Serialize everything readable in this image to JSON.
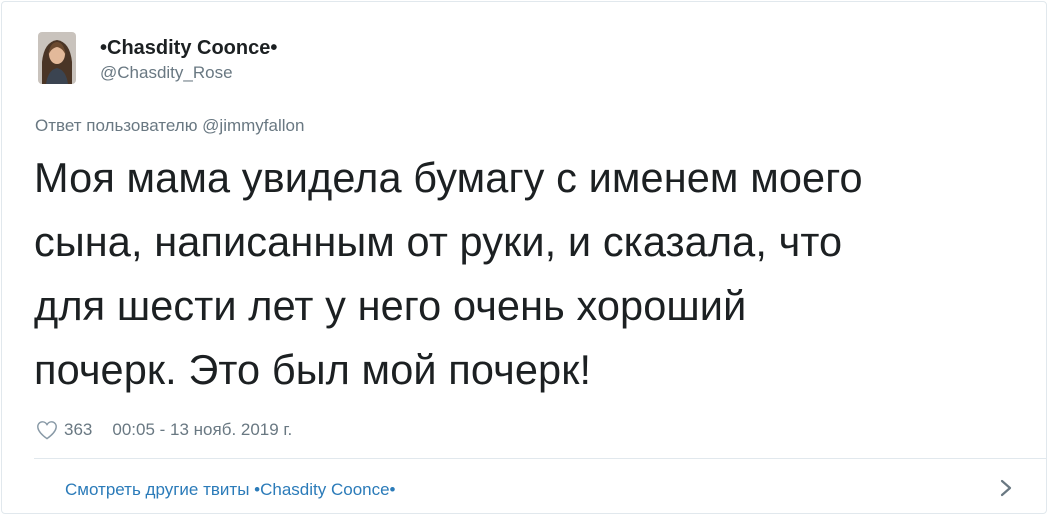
{
  "author": {
    "display_name": "•Chasdity Coonce•",
    "handle": "@Chasdity_Rose",
    "avatar_icon": "profile-photo"
  },
  "reply_to": "Ответ пользователю @jimmyfallon",
  "tweet": {
    "text_lines": [
      "Моя мама увидела бумагу с именем моего",
      "сына, написанным от руки, и сказала, что",
      "для шести лет у него очень хороший",
      "почерк. Это был мой почерк!"
    ]
  },
  "meta": {
    "heart_icon": "heart-outline",
    "likes": "363",
    "timestamp": "00:05 - 13 нояб. 2019 г."
  },
  "footer": {
    "link_text": "Смотреть другие твиты •Chasdity Coonce•",
    "chevron_icon": "chevron-right"
  },
  "colors": {
    "text": "#1c2022",
    "secondary": "#697882",
    "link": "#2b7bb9",
    "border": "#e1e8ed"
  }
}
